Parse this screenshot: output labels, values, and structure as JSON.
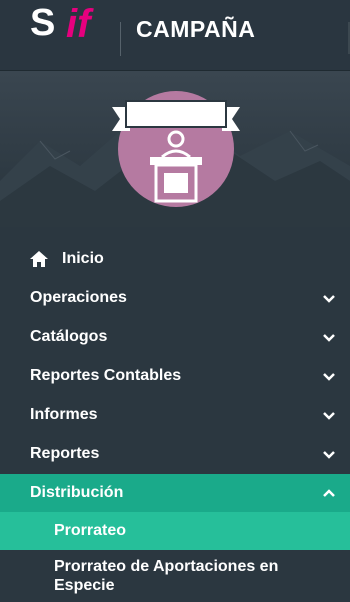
{
  "header": {
    "logo_s": "S",
    "logo_if": "if",
    "title": "CAMPAÑA"
  },
  "banner": {
    "icon": "podium-speaker-icon"
  },
  "menu": {
    "home": {
      "label": "Inicio",
      "icon": "home-icon"
    },
    "items": [
      {
        "label": "Operaciones",
        "icon": "chevron-down-icon"
      },
      {
        "label": "Catálogos",
        "icon": "chevron-down-icon"
      },
      {
        "label": "Reportes Contables",
        "icon": "chevron-down-icon"
      },
      {
        "label": "Informes",
        "icon": "chevron-down-icon"
      },
      {
        "label": "Reportes",
        "icon": "chevron-down-icon"
      },
      {
        "label": "Distribución",
        "icon": "chevron-up-icon",
        "expanded": true
      }
    ],
    "sub_items": [
      {
        "label": "Prorrateo",
        "active": true
      },
      {
        "label_line1": "Prorrateo de Aportaciones en",
        "label_line2": "Especie"
      }
    ]
  },
  "colors": {
    "background": "#2b3740",
    "accent_teal": "#1aaa8a",
    "accent_teal_light": "#26bf9a",
    "brand_pink": "#e6007e",
    "circle_mauve": "#b57aa1"
  }
}
